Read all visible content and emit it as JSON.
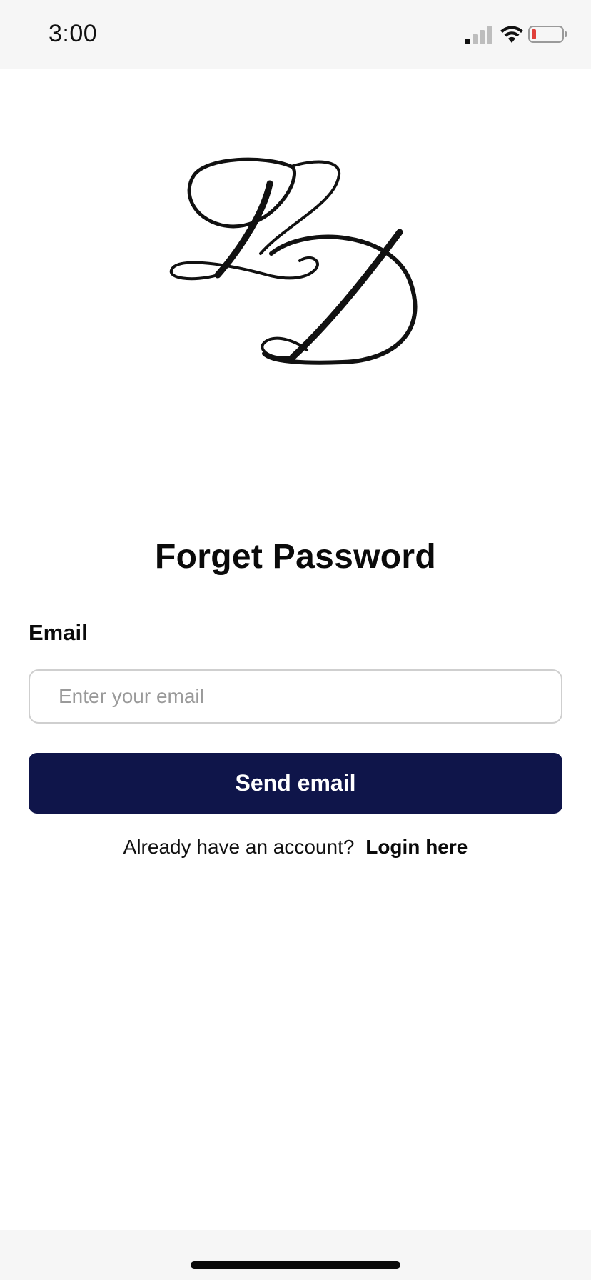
{
  "status_bar": {
    "time": "3:00",
    "icons": [
      "signal-icon",
      "wifi-icon",
      "battery-icon"
    ],
    "battery_color": "#e0403a"
  },
  "logo": {
    "text": "LD"
  },
  "page_title": "Forget Password",
  "form": {
    "email_label": "Email",
    "email_placeholder": "Enter your email",
    "email_value": "",
    "submit_label": "Send email"
  },
  "footer": {
    "prompt": "Already have an account?",
    "login_link": "Login here"
  },
  "colors": {
    "primary_button": "#0f154a",
    "background": "#ffffff",
    "system_bar": "#f6f6f6"
  }
}
